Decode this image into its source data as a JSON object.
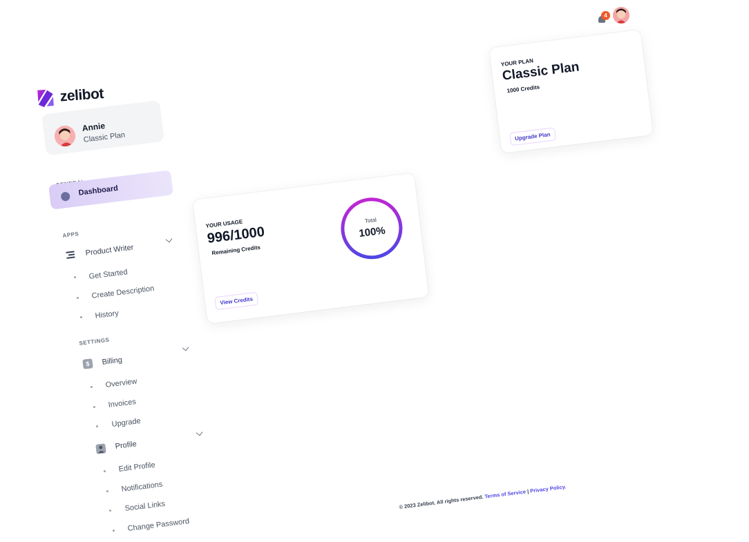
{
  "app": {
    "name": "zelibot"
  },
  "topbar": {
    "notification_count": "4"
  },
  "user": {
    "name": "Annie",
    "plan": "Classic Plan"
  },
  "sidebar": {
    "general_label": "GENERAL",
    "dashboard": "Dashboard",
    "apps_label": "APPS",
    "product_writer": "Product Writer",
    "product_writer_items": [
      "Get Started",
      "Create Description",
      "History"
    ],
    "settings_label": "SETTINGS",
    "billing": "Billing",
    "billing_items": [
      "Overview",
      "Invoices",
      "Upgrade"
    ],
    "profile": "Profile",
    "profile_items": [
      "Edit Profile",
      "Notifications",
      "Social Links",
      "Change Password"
    ]
  },
  "usage": {
    "label": "YOUR USAGE",
    "value": "996/1000",
    "sub": "Remaining Credits",
    "button": "View Credits",
    "ring_label": "Total",
    "ring_value": "100%",
    "percent": 100
  },
  "plan": {
    "label": "YOUR PLAN",
    "title": "Classic Plan",
    "credits": "1000 Credits",
    "button": "Upgrade Plan"
  },
  "footer": {
    "copyright": "© 2023 Zelibot. All rights reserved.",
    "terms": "Terms of Service",
    "separator": "|",
    "privacy": "Privacy Policy."
  },
  "colors": {
    "accent": "#4338ca",
    "ring_start": "#c026d3",
    "ring_end": "#4f46e5",
    "active_bg": "#d9cdf6",
    "badge": "#f05a28"
  }
}
